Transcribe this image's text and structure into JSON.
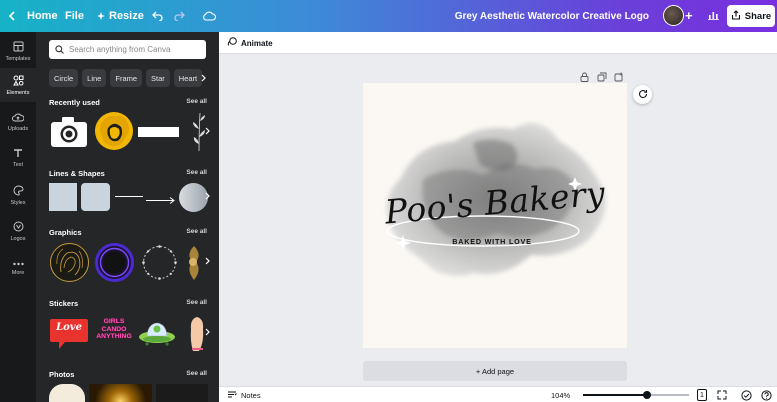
{
  "topbar": {
    "back_label": "Home",
    "file_label": "File",
    "resize_label": "Resize",
    "doc_title": "Grey Aesthetic Watercolor Creative Logo",
    "plus_label": "+",
    "share_label": "Share"
  },
  "rail": {
    "items": [
      {
        "label": "Templates",
        "icon": "templates-icon"
      },
      {
        "label": "Elements",
        "icon": "elements-icon"
      },
      {
        "label": "Uploads",
        "icon": "upload-icon"
      },
      {
        "label": "Text",
        "icon": "text-icon"
      },
      {
        "label": "Styles",
        "icon": "styles-icon"
      },
      {
        "label": "Logos",
        "icon": "logos-icon"
      },
      {
        "label": "More",
        "icon": "more-icon"
      }
    ]
  },
  "panel": {
    "search_placeholder": "Search anything from Canva",
    "chips": [
      "Circle",
      "Line",
      "Frame",
      "Star",
      "Heart"
    ],
    "see_all": "See all",
    "sections": {
      "recent": "Recently used",
      "lines_shapes": "Lines & Shapes",
      "graphics": "Graphics",
      "stickers": "Stickers",
      "photos": "Photos"
    },
    "sticker_love": "Love",
    "sticker_girls": "GIRLS CANDO ANYTHING"
  },
  "editor": {
    "animate_label": "Animate",
    "add_page_label": "+ Add page",
    "logo_script": "Poo's Bakery",
    "logo_tagline": "BAKED WITH LOVE"
  },
  "bottombar": {
    "notes_label": "Notes",
    "zoom": "104%",
    "zoom_fraction": 0.6,
    "page_count": "1"
  },
  "colors": {
    "accent_gradient_start": "#16b3c7",
    "accent_gradient_end": "#7a2fe0",
    "panel_bg": "#252627",
    "rail_bg": "#18191b"
  }
}
